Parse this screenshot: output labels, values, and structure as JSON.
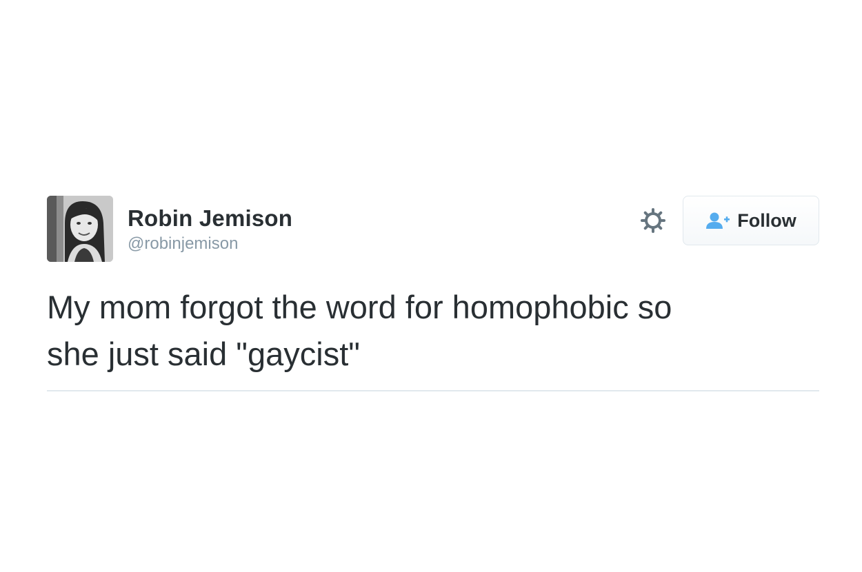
{
  "tweet": {
    "author": {
      "name": "Robin Jemison",
      "handle": "@robinjemison",
      "avatar": "profile-photo"
    },
    "actions": {
      "settings_icon": "gear-icon",
      "follow_label": "Follow",
      "follow_icon": "person-add-icon"
    },
    "text_lines": [
      "My mom forgot the word for homophobic so",
      "she just said \"gaycist\""
    ]
  },
  "colors": {
    "text": "#292f33",
    "secondary": "#8899a6",
    "accent": "#55acee",
    "divider": "#e1e8ed"
  }
}
